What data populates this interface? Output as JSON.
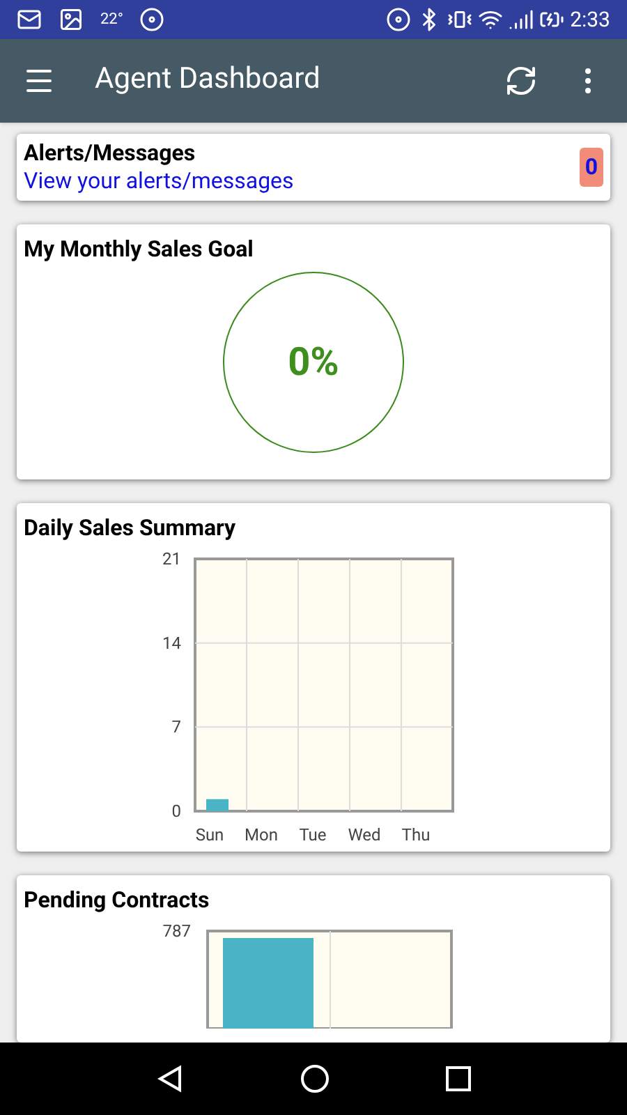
{
  "status_bar": {
    "temperature": "22°",
    "time": "2:33"
  },
  "app_bar": {
    "title": "Agent Dashboard"
  },
  "alerts": {
    "title": "Alerts/Messages",
    "link": "View your alerts/messages",
    "count": "0"
  },
  "sales_goal": {
    "title": "My Monthly Sales Goal",
    "percent": "0%"
  },
  "daily_sales": {
    "title": "Daily Sales Summary",
    "chart_data": {
      "type": "bar",
      "categories": [
        "Sun",
        "Mon",
        "Tue",
        "Wed",
        "Thu"
      ],
      "series": [
        {
          "color": "#4ab3c6",
          "values": [
            1,
            0,
            0,
            0,
            0
          ]
        }
      ],
      "ylim": [
        0,
        21
      ],
      "yticks": [
        0,
        7,
        14,
        21
      ]
    }
  },
  "pending_contracts": {
    "title": "Pending Contracts",
    "y_tick_label": "787"
  }
}
